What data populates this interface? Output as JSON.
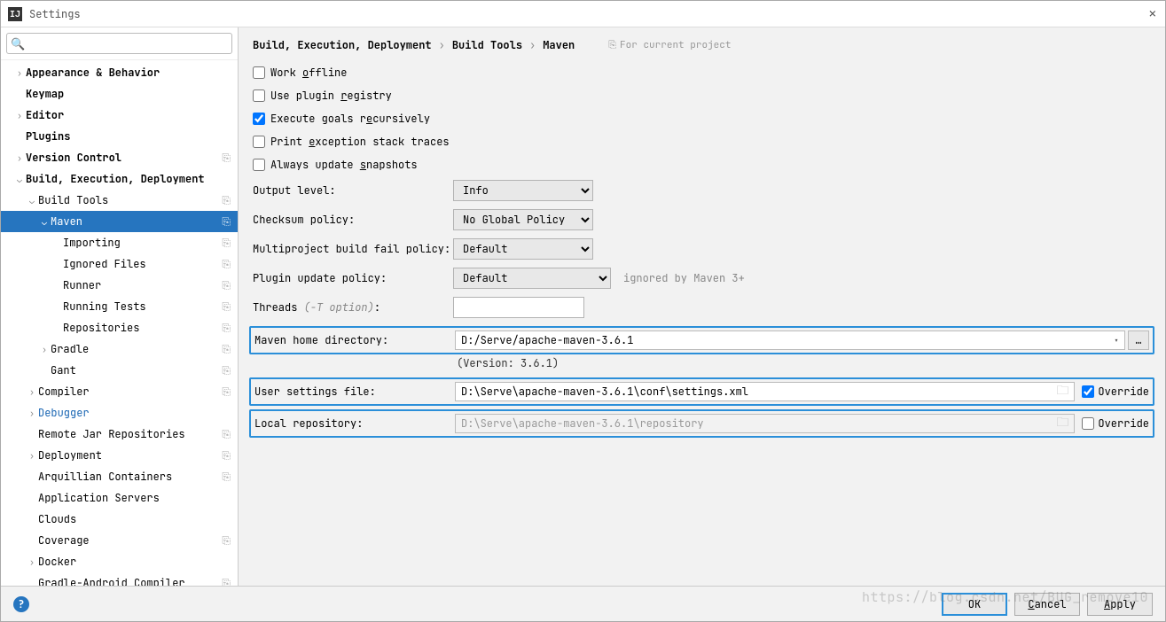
{
  "window": {
    "title": "Settings"
  },
  "search": {
    "placeholder": ""
  },
  "tree": [
    {
      "label": "Appearance & Behavior",
      "indent": 0,
      "chevron": "right",
      "bold": true
    },
    {
      "label": "Keymap",
      "indent": 0,
      "chevron": "",
      "bold": true
    },
    {
      "label": "Editor",
      "indent": 0,
      "chevron": "right",
      "bold": true
    },
    {
      "label": "Plugins",
      "indent": 0,
      "chevron": "",
      "bold": true
    },
    {
      "label": "Version Control",
      "indent": 0,
      "chevron": "right",
      "bold": true,
      "proj": true
    },
    {
      "label": "Build, Execution, Deployment",
      "indent": 0,
      "chevron": "down",
      "bold": true
    },
    {
      "label": "Build Tools",
      "indent": 1,
      "chevron": "down",
      "proj": true
    },
    {
      "label": "Maven",
      "indent": 2,
      "chevron": "down",
      "proj": true,
      "selected": true
    },
    {
      "label": "Importing",
      "indent": 3,
      "chevron": "",
      "proj": true
    },
    {
      "label": "Ignored Files",
      "indent": 3,
      "chevron": "",
      "proj": true
    },
    {
      "label": "Runner",
      "indent": 3,
      "chevron": "",
      "proj": true
    },
    {
      "label": "Running Tests",
      "indent": 3,
      "chevron": "",
      "proj": true
    },
    {
      "label": "Repositories",
      "indent": 3,
      "chevron": "",
      "proj": true
    },
    {
      "label": "Gradle",
      "indent": 2,
      "chevron": "right",
      "proj": true
    },
    {
      "label": "Gant",
      "indent": 2,
      "chevron": "",
      "proj": true
    },
    {
      "label": "Compiler",
      "indent": 1,
      "chevron": "right",
      "proj": true
    },
    {
      "label": "Debugger",
      "indent": 1,
      "chevron": "right",
      "blue": true
    },
    {
      "label": "Remote Jar Repositories",
      "indent": 1,
      "chevron": "",
      "proj": true
    },
    {
      "label": "Deployment",
      "indent": 1,
      "chevron": "right",
      "proj": true
    },
    {
      "label": "Arquillian Containers",
      "indent": 1,
      "chevron": "",
      "proj": true
    },
    {
      "label": "Application Servers",
      "indent": 1,
      "chevron": ""
    },
    {
      "label": "Clouds",
      "indent": 1,
      "chevron": ""
    },
    {
      "label": "Coverage",
      "indent": 1,
      "chevron": "",
      "proj": true
    },
    {
      "label": "Docker",
      "indent": 1,
      "chevron": "right"
    },
    {
      "label": "Gradle-Android Compiler",
      "indent": 1,
      "chevron": "",
      "proj": true
    }
  ],
  "breadcrumb": {
    "a": "Build, Execution, Deployment",
    "b": "Build Tools",
    "c": "Maven",
    "hint": "For current project"
  },
  "checks": {
    "work_offline": "Work offline",
    "plugin_registry": "Use plugin registry",
    "execute_recursive": "Execute goals recursively",
    "print_exception": "Print exception stack traces",
    "always_snapshots": "Always update snapshots"
  },
  "labels": {
    "output_level": "Output level:",
    "checksum_policy": "Checksum policy:",
    "multiproject": "Multiproject build fail policy:",
    "plugin_update": "Plugin update policy:",
    "plugin_update_aside": "ignored by Maven 3+",
    "threads": "Threads ",
    "threads_opt": "(-T option)",
    "threads_colon": ":",
    "maven_home": "Maven home directory:",
    "version": "(Version: 3.6.1)",
    "user_settings": "User settings file:",
    "local_repo": "Local repository:",
    "override": "Override"
  },
  "values": {
    "output_level": "Info",
    "checksum_policy": "No Global Policy",
    "multiproject": "Default",
    "plugin_update": "Default",
    "threads": "",
    "maven_home": "D:/Serve/apache-maven-3.6.1",
    "user_settings": "D:\\Serve\\apache-maven-3.6.1\\conf\\settings.xml",
    "local_repo": "D:\\Serve\\apache-maven-3.6.1\\repository"
  },
  "buttons": {
    "ok": "OK",
    "cancel": "Cancel",
    "apply": "Apply"
  }
}
